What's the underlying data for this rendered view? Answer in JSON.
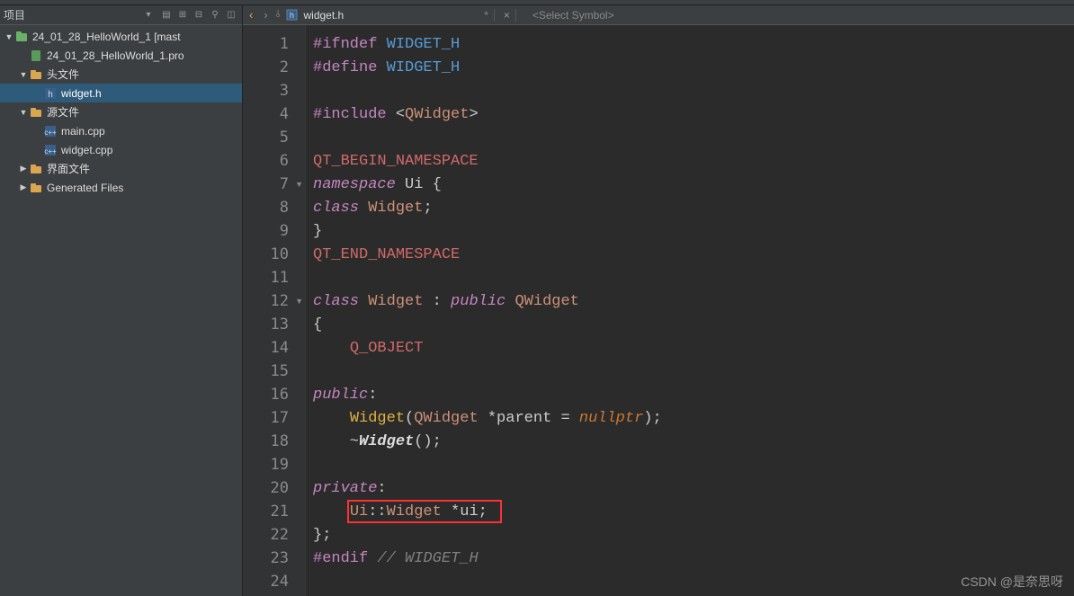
{
  "sidebar": {
    "title": "项目",
    "tools": [
      "▾",
      "▱",
      "⊞",
      "⊟",
      "⚲",
      "□"
    ],
    "tree": [
      {
        "level": 0,
        "arrow": "down",
        "icon": "project",
        "label": "24_01_28_HelloWorld_1 [mast"
      },
      {
        "level": 1,
        "arrow": "",
        "icon": "pro",
        "label": "24_01_28_HelloWorld_1.pro"
      },
      {
        "level": 1,
        "arrow": "down",
        "icon": "folder",
        "label": "头文件"
      },
      {
        "level": 2,
        "arrow": "",
        "icon": "h",
        "label": "widget.h",
        "selected": true
      },
      {
        "level": 1,
        "arrow": "down",
        "icon": "folder",
        "label": "源文件"
      },
      {
        "level": 2,
        "arrow": "",
        "icon": "cpp",
        "label": "main.cpp"
      },
      {
        "level": 2,
        "arrow": "",
        "icon": "cpp",
        "label": "widget.cpp"
      },
      {
        "level": 1,
        "arrow": "right",
        "icon": "folder",
        "label": "界面文件"
      },
      {
        "level": 1,
        "arrow": "right",
        "icon": "folder",
        "label": "Generated Files"
      }
    ]
  },
  "editor": {
    "tab_name": "widget.h",
    "tab_modified": "*",
    "tab_close": "×",
    "symbol_placeholder": "<Select Symbol>",
    "lines": [
      {
        "n": 1,
        "fold": "",
        "tokens": [
          [
            "pp",
            "#ifndef "
          ],
          [
            "macro",
            "WIDGET_H"
          ]
        ]
      },
      {
        "n": 2,
        "fold": "",
        "tokens": [
          [
            "pp",
            "#define "
          ],
          [
            "macro",
            "WIDGET_H"
          ]
        ]
      },
      {
        "n": 3,
        "fold": "",
        "tokens": []
      },
      {
        "n": 4,
        "fold": "",
        "tokens": [
          [
            "pp",
            "#include "
          ],
          [
            "op",
            "<"
          ],
          [
            "type",
            "QWidget"
          ],
          [
            "op",
            ">"
          ]
        ]
      },
      {
        "n": 5,
        "fold": "",
        "tokens": []
      },
      {
        "n": 6,
        "fold": "",
        "tokens": [
          [
            "pink",
            "QT_BEGIN_NAMESPACE"
          ]
        ]
      },
      {
        "n": 7,
        "fold": "▼",
        "tokens": [
          [
            "kw",
            "namespace"
          ],
          [
            "ident",
            " Ui "
          ],
          [
            "op",
            "{"
          ]
        ]
      },
      {
        "n": 8,
        "fold": "",
        "tokens": [
          [
            "kw",
            "class"
          ],
          [
            "ident",
            " "
          ],
          [
            "type",
            "Widget"
          ],
          [
            "op",
            ";"
          ]
        ]
      },
      {
        "n": 9,
        "fold": "",
        "tokens": [
          [
            "op",
            "}"
          ]
        ]
      },
      {
        "n": 10,
        "fold": "",
        "tokens": [
          [
            "pink",
            "QT_END_NAMESPACE"
          ]
        ]
      },
      {
        "n": 11,
        "fold": "",
        "tokens": []
      },
      {
        "n": 12,
        "fold": "▼",
        "tokens": [
          [
            "kw",
            "class"
          ],
          [
            "ident",
            " "
          ],
          [
            "type",
            "Widget"
          ],
          [
            "ident",
            " : "
          ],
          [
            "kw",
            "public"
          ],
          [
            "ident",
            " "
          ],
          [
            "type",
            "QWidget"
          ]
        ]
      },
      {
        "n": 13,
        "fold": "",
        "tokens": [
          [
            "op",
            "{"
          ]
        ]
      },
      {
        "n": 14,
        "fold": "",
        "tokens": [
          [
            "ident",
            "    "
          ],
          [
            "pink",
            "Q_OBJECT"
          ]
        ]
      },
      {
        "n": 15,
        "fold": "",
        "tokens": []
      },
      {
        "n": 16,
        "fold": "",
        "tokens": [
          [
            "kw",
            "public"
          ],
          [
            "op",
            ":"
          ]
        ]
      },
      {
        "n": 17,
        "fold": "",
        "tokens": [
          [
            "ident",
            "    "
          ],
          [
            "func",
            "Widget"
          ],
          [
            "op",
            "("
          ],
          [
            "type",
            "QWidget"
          ],
          [
            "ident",
            " *parent = "
          ],
          [
            "null",
            "nullptr"
          ],
          [
            "op",
            ");"
          ]
        ]
      },
      {
        "n": 18,
        "fold": "",
        "tokens": [
          [
            "ident",
            "    ~"
          ],
          [
            "funcbold",
            "Widget"
          ],
          [
            "op",
            "();"
          ]
        ]
      },
      {
        "n": 19,
        "fold": "",
        "tokens": []
      },
      {
        "n": 20,
        "fold": "",
        "tokens": [
          [
            "kw",
            "private"
          ],
          [
            "op",
            ":"
          ]
        ]
      },
      {
        "n": 21,
        "fold": "",
        "tokens": [
          [
            "ident",
            "    "
          ],
          [
            "type",
            "Ui"
          ],
          [
            "op",
            "::"
          ],
          [
            "type",
            "Widget"
          ],
          [
            "ident",
            " *ui;"
          ]
        ]
      },
      {
        "n": 22,
        "fold": "",
        "tokens": [
          [
            "op",
            "};"
          ]
        ]
      },
      {
        "n": 23,
        "fold": "",
        "tokens": [
          [
            "pp",
            "#endif "
          ],
          [
            "comment",
            "// WIDGET_H"
          ]
        ]
      },
      {
        "n": 24,
        "fold": "",
        "tokens": []
      }
    ],
    "highlight": {
      "line": 21,
      "text": "Ui::Widget *ui;"
    }
  },
  "watermark": "CSDN @是奈思呀"
}
